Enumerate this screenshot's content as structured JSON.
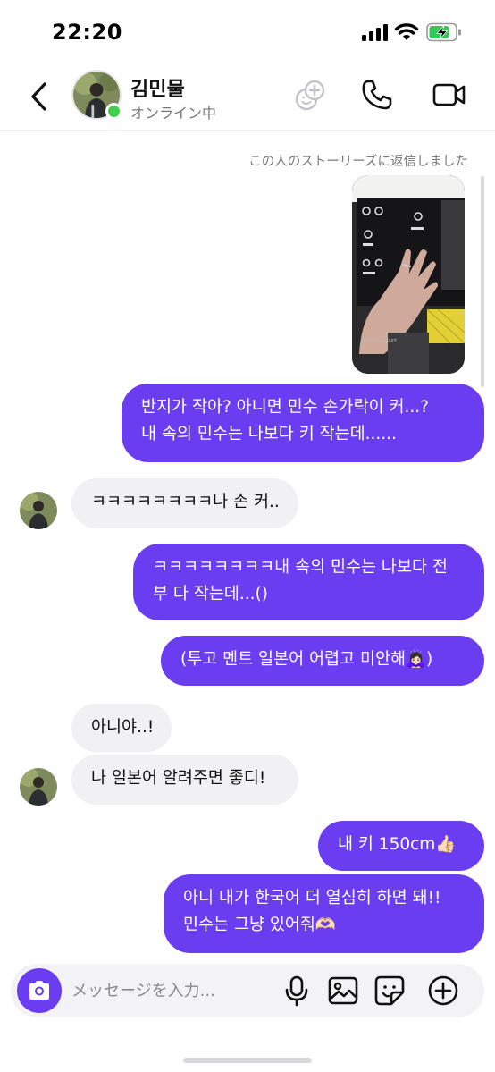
{
  "status_bar": {
    "time": "22:20"
  },
  "header": {
    "contact_name": "김민물",
    "contact_status": "オンライン中"
  },
  "story_reply": {
    "note": "この人のストーリーズに返信しました",
    "thumbnail_watermark": "@some.account"
  },
  "messages": [
    {
      "direction": "out",
      "lines": [
        "반지가 작아? 아니면 민수 손가락이 커...?",
        "내 속의 민수는 나보다 키 작는데......"
      ]
    },
    {
      "direction": "in",
      "lines": [
        "ㅋㅋㅋㅋㅋㅋㅋㅋ나 손 커.."
      ]
    },
    {
      "direction": "out",
      "lines": [
        "ㅋㅋㅋㅋㅋㅋㅋㅋ내 속의 민수는 나보다 전",
        "부 다 작는데...()"
      ]
    },
    {
      "direction": "out",
      "lines": [
        "(투고 멘트 일본어 어렵고 미안해🙇🏻‍♀️)"
      ]
    },
    {
      "direction": "in",
      "lines": [
        "아니야..!"
      ]
    },
    {
      "direction": "in",
      "lines": [
        "나 일본어 알려주면 좋디!"
      ]
    },
    {
      "direction": "out",
      "lines": [
        "내 키 150cm👍🏻"
      ]
    },
    {
      "direction": "out",
      "lines": [
        "아니 내가 한국어 더 열심히 하면 돼!!",
        "민수는 그냥 있어줘🫶🏻"
      ]
    }
  ],
  "input": {
    "placeholder": "メッセージを入力..."
  },
  "colors": {
    "accent": "#6b3df0",
    "incoming_bubble": "#f1f1f3",
    "online": "#3fcf4f"
  }
}
